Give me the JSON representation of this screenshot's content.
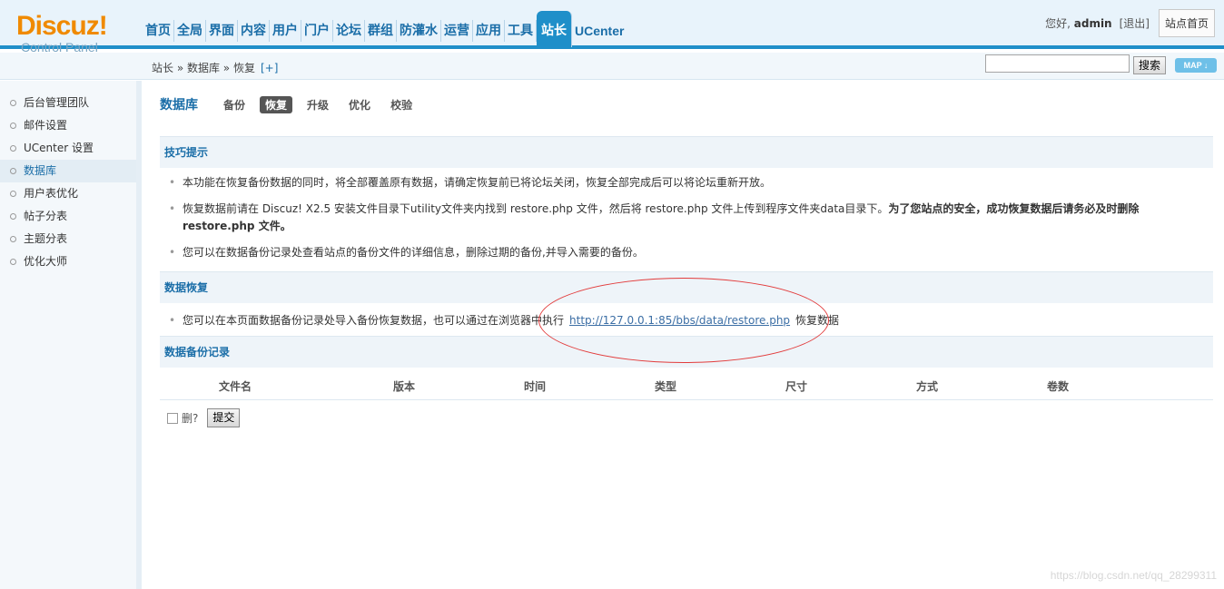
{
  "logo": {
    "main": "Discuz!",
    "sub": "Control Panel"
  },
  "topnav": [
    "首页",
    "全局",
    "界面",
    "内容",
    "用户",
    "门户",
    "论坛",
    "群组",
    "防灌水",
    "运营",
    "应用",
    "工具",
    "站长",
    "UCenter"
  ],
  "user": {
    "greeting": "您好,",
    "name": "admin",
    "logout": "[退出]",
    "site_home": "站点首页"
  },
  "breadcrumb": {
    "path": "站长 » 数据库 » 恢复",
    "plus": "[+]"
  },
  "search": {
    "placeholder": "",
    "button": "搜索",
    "map": "MAP ↓"
  },
  "sidebar": {
    "items": [
      {
        "label": "后台管理团队"
      },
      {
        "label": "邮件设置"
      },
      {
        "label": "UCenter 设置"
      },
      {
        "label": "数据库"
      },
      {
        "label": "用户表优化"
      },
      {
        "label": "帖子分表"
      },
      {
        "label": "主题分表"
      },
      {
        "label": "优化大师"
      }
    ],
    "active_index": 3
  },
  "main": {
    "title": "数据库",
    "tabs": [
      "备份",
      "恢复",
      "升级",
      "优化",
      "校验"
    ],
    "active_tab": 1,
    "tips_header": "技巧提示",
    "tips": {
      "t1": "本功能在恢复备份数据的同时，将全部覆盖原有数据，请确定恢复前已将论坛关闭，恢复全部完成后可以将论坛重新开放。",
      "t2a": "恢复数据前请在 Discuz! X2.5 安装文件目录下utility文件夹内找到 restore.php 文件，然后将 restore.php 文件上传到程序文件夹data目录下。",
      "t2b": "为了您站点的安全，成功恢复数据后请务必及时删除",
      "t2c": "restore.php 文件。",
      "t3": "您可以在数据备份记录处查看站点的备份文件的详细信息，删除过期的备份,并导入需要的备份。"
    },
    "restore_header": "数据恢复",
    "restore": {
      "before": "您可以在本页面数据备份记录处导入备份恢复数据，也可以通过在浏览器中执行",
      "link": "http://127.0.0.1:85/bbs/data/restore.php",
      "after": "恢复数据"
    },
    "records_header": "数据备份记录",
    "columns": [
      "文件名",
      "版本",
      "时间",
      "类型",
      "尺寸",
      "方式",
      "卷数"
    ],
    "delete_label": "删?",
    "submit": "提交"
  },
  "watermark": "https://blog.csdn.net/qq_28299311",
  "colors": {
    "accent": "#1f8fc9",
    "logo": "#f08a00",
    "annotation": "#e23b3b"
  }
}
